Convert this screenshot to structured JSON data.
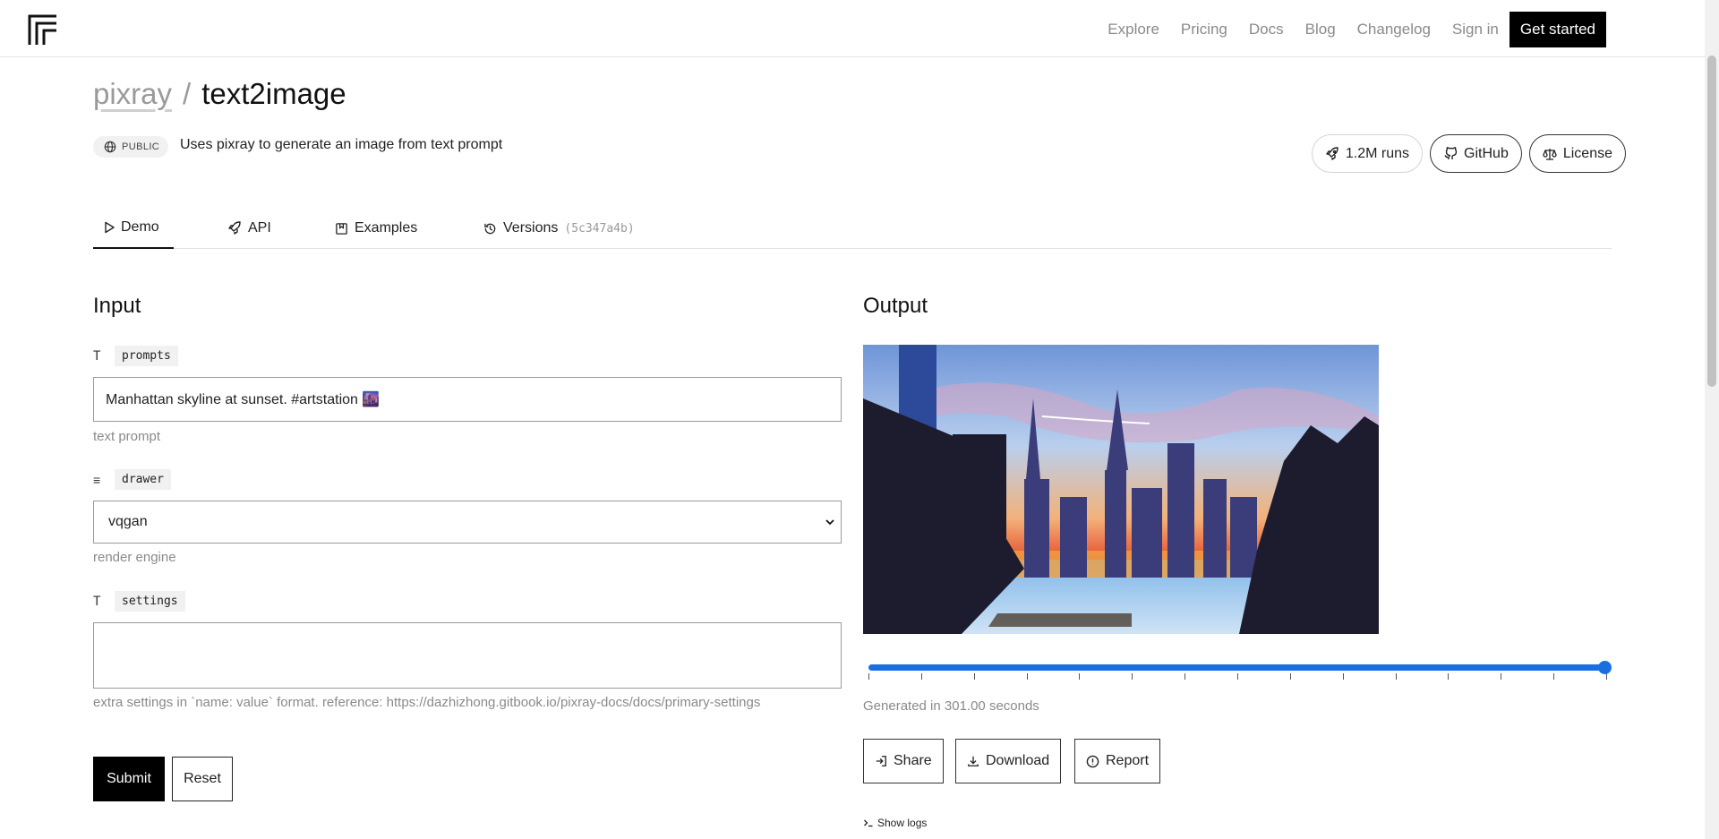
{
  "nav": {
    "logo": "replicate-logo",
    "links": [
      "Explore",
      "Pricing",
      "Docs",
      "Blog",
      "Changelog",
      "Sign in"
    ],
    "cta": "Get started"
  },
  "header": {
    "owner": "pixray",
    "separator": "/",
    "model": "text2image",
    "visibility": "PUBLIC",
    "description": "Uses pixray to generate an image from text prompt",
    "runs": "1.2M runs",
    "github": "GitHub",
    "license": "License"
  },
  "tabs": {
    "demo": "Demo",
    "api": "API",
    "examples": "Examples",
    "versions": "Versions",
    "version_hash": "(5c347a4b)"
  },
  "input": {
    "title": "Input",
    "fields": {
      "prompts": {
        "type_icon": "T",
        "name": "prompts",
        "value": "Manhattan skyline at sunset. #artstation 🌆",
        "help": "text prompt"
      },
      "drawer": {
        "type_icon": "≡",
        "name": "drawer",
        "value": "vqgan",
        "help": "render engine"
      },
      "settings": {
        "type_icon": "T",
        "name": "settings",
        "value": "",
        "help": "extra settings in `name: value` format. reference: https://dazhizhong.gitbook.io/pixray-docs/docs/primary-settings"
      }
    },
    "submit": "Submit",
    "reset": "Reset"
  },
  "output": {
    "title": "Output",
    "image_alt": "Generated painting of Manhattan skyline at sunset",
    "progress_fraction": 1.0,
    "generated": "Generated in 301.00 seconds",
    "share": "Share",
    "download": "Download",
    "report": "Report",
    "logs": "Show logs"
  },
  "colors": {
    "accent": "#1a6fe0",
    "primary_button": "#000000"
  }
}
